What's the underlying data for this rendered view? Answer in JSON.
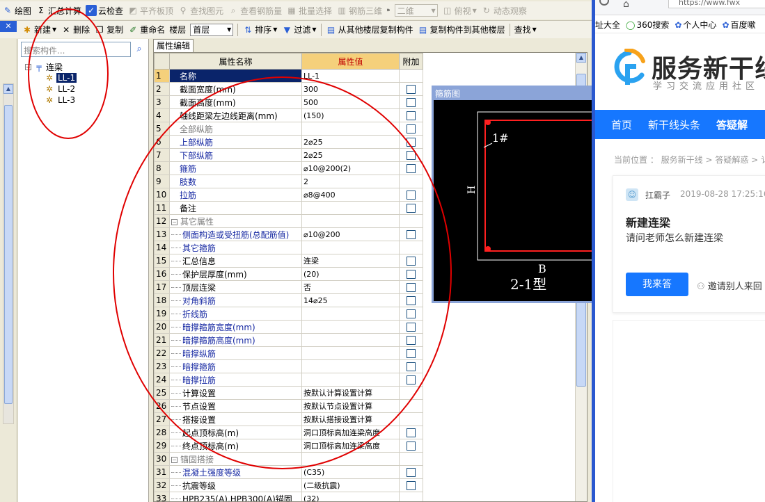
{
  "toolbar1": {
    "draw": "绘图",
    "sum": "汇总计算",
    "cloud_check": "云检查",
    "flat_top": "平齐板顶",
    "find_elem": "查找图元",
    "view_rebar_qty": "查看钢筋量",
    "batch_select": "批量选择",
    "rebar_3d": "钢筋三维",
    "view_mode": "二维",
    "top_view": "俯视",
    "dynamic_view": "动态观察"
  },
  "toolbar2": {
    "new": "新建",
    "delete": "删除",
    "copy": "复制",
    "rename": "重命名",
    "floor_label": "楼层",
    "floor_value": "首层",
    "sort": "排序",
    "filter": "过滤",
    "copy_from_floor": "从其他楼层复制构件",
    "copy_to_floor": "复制构件到其他楼层",
    "find": "查找"
  },
  "tree": {
    "search_placeholder": "搜索构件...",
    "root": "连梁",
    "items": [
      "LL-1",
      "LL-2",
      "LL-3"
    ]
  },
  "grid": {
    "tab": "属性编辑",
    "col_name": "属性名称",
    "col_value": "属性值",
    "col_attach": "附加",
    "rows": [
      {
        "n": "1",
        "name": "名称",
        "value": "LL-1",
        "style": "sel",
        "lvl": 0,
        "chk": false
      },
      {
        "n": "2",
        "name": "截面宽度(mm)",
        "value": "300",
        "style": "",
        "lvl": 0,
        "chk": true
      },
      {
        "n": "3",
        "name": "截面高度(mm)",
        "value": "500",
        "style": "",
        "lvl": 0,
        "chk": true
      },
      {
        "n": "4",
        "name": "轴线距梁左边线距离(mm)",
        "value": "(150)",
        "style": "",
        "lvl": 0,
        "chk": true
      },
      {
        "n": "5",
        "name": "全部纵筋",
        "value": "",
        "style": "gray",
        "lvl": 0,
        "chk": true
      },
      {
        "n": "6",
        "name": "上部纵筋",
        "value": "2⌀25",
        "style": "blue",
        "lvl": 0,
        "chk": true
      },
      {
        "n": "7",
        "name": "下部纵筋",
        "value": "2⌀25",
        "style": "blue",
        "lvl": 0,
        "chk": true
      },
      {
        "n": "8",
        "name": "箍筋",
        "value": "⌀10@200(2)",
        "style": "blue",
        "lvl": 0,
        "chk": true
      },
      {
        "n": "9",
        "name": "肢数",
        "value": "2",
        "style": "blue",
        "lvl": 0,
        "chk": false
      },
      {
        "n": "10",
        "name": "拉筋",
        "value": "⌀8@400",
        "style": "blue",
        "lvl": 0,
        "chk": true
      },
      {
        "n": "11",
        "name": "备注",
        "value": "",
        "style": "",
        "lvl": 0,
        "chk": true
      },
      {
        "n": "12",
        "name": "其它属性",
        "value": "",
        "style": "gray",
        "lvl": 0,
        "chk": false,
        "group": true
      },
      {
        "n": "13",
        "name": "侧面构造或受扭筋(总配筋值)",
        "value": "⌀10@200",
        "style": "blue",
        "lvl": 1,
        "chk": true
      },
      {
        "n": "14",
        "name": "其它箍筋",
        "value": "",
        "style": "blue",
        "lvl": 1,
        "chk": false
      },
      {
        "n": "15",
        "name": "汇总信息",
        "value": "连梁",
        "style": "",
        "lvl": 1,
        "chk": true
      },
      {
        "n": "16",
        "name": "保护层厚度(mm)",
        "value": "(20)",
        "style": "",
        "lvl": 1,
        "chk": true
      },
      {
        "n": "17",
        "name": "顶层连梁",
        "value": "否",
        "style": "",
        "lvl": 1,
        "chk": true
      },
      {
        "n": "18",
        "name": "对角斜筋",
        "value": "14⌀25",
        "style": "blue",
        "lvl": 1,
        "chk": true
      },
      {
        "n": "19",
        "name": "折线筋",
        "value": "",
        "style": "blue",
        "lvl": 1,
        "chk": true
      },
      {
        "n": "20",
        "name": "暗撑箍筋宽度(mm)",
        "value": "",
        "style": "blue",
        "lvl": 1,
        "chk": true
      },
      {
        "n": "21",
        "name": "暗撑箍筋高度(mm)",
        "value": "",
        "style": "blue",
        "lvl": 1,
        "chk": true
      },
      {
        "n": "22",
        "name": "暗撑纵筋",
        "value": "",
        "style": "blue",
        "lvl": 1,
        "chk": true
      },
      {
        "n": "23",
        "name": "暗撑箍筋",
        "value": "",
        "style": "blue",
        "lvl": 1,
        "chk": true
      },
      {
        "n": "24",
        "name": "暗撑拉筋",
        "value": "",
        "style": "blue",
        "lvl": 1,
        "chk": true
      },
      {
        "n": "25",
        "name": "计算设置",
        "value": "按默认计算设置计算",
        "style": "",
        "lvl": 1,
        "chk": false
      },
      {
        "n": "26",
        "name": "节点设置",
        "value": "按默认节点设置计算",
        "style": "",
        "lvl": 1,
        "chk": false
      },
      {
        "n": "27",
        "name": "搭接设置",
        "value": "按默认搭接设置计算",
        "style": "",
        "lvl": 1,
        "chk": false
      },
      {
        "n": "28",
        "name": "起点顶标高(m)",
        "value": "洞口顶标高加连梁高度",
        "style": "",
        "lvl": 1,
        "chk": true
      },
      {
        "n": "29",
        "name": "终点顶标高(m)",
        "value": "洞口顶标高加连梁高度",
        "style": "",
        "lvl": 1,
        "chk": true
      },
      {
        "n": "30",
        "name": "锚固搭接",
        "value": "",
        "style": "gray",
        "lvl": 0,
        "chk": false,
        "group": true
      },
      {
        "n": "31",
        "name": "混凝土强度等级",
        "value": "(C35)",
        "style": "blue",
        "lvl": 1,
        "chk": true
      },
      {
        "n": "32",
        "name": "抗震等级",
        "value": "(二级抗震)",
        "style": "",
        "lvl": 1,
        "chk": true
      },
      {
        "n": "33",
        "name": "HPB235(A),HPB300(A)锚固",
        "value": "(32)",
        "style": "",
        "lvl": 1,
        "chk": false
      }
    ]
  },
  "rebar_window": {
    "title": "箍筋图",
    "label_1": "1#",
    "label_h": "H",
    "label_b": "B",
    "type_label": "2-1型"
  },
  "browser": {
    "url": "https://www.fwx",
    "bookmarks": [
      "址大全",
      "360搜索",
      "个人中心",
      "百度嗽"
    ],
    "logo_name": "服务新干线",
    "logo_sub": "学习交流应用社区",
    "nav": [
      "首页",
      "新干线头条",
      "答疑解"
    ],
    "breadcrumb": "当前位置 ： 服务新干线 > 答疑解惑 > 讠",
    "question": {
      "user": "扛霸子",
      "time": "2019-08-28 17:25:16",
      "title": "新建连梁",
      "body": "请问老师怎么新建连梁",
      "answer_btn": "我来答",
      "invite": "邀请别人来回"
    }
  },
  "colors": {
    "annotation": "#e00000",
    "accent": "#1677ff",
    "selection": "#0a246a",
    "header_value": "#f5d07b"
  }
}
